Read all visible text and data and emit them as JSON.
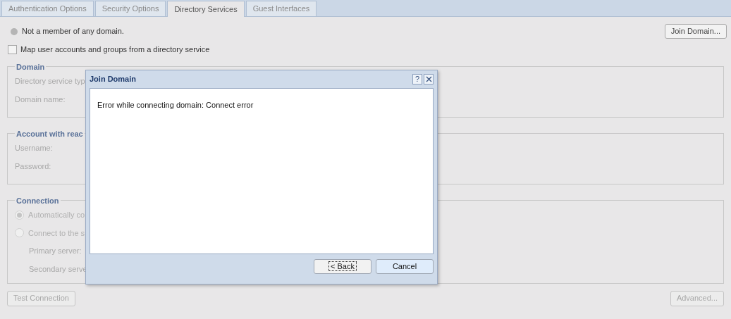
{
  "tabs": [
    {
      "label": "Authentication Options",
      "selected": false
    },
    {
      "label": "Security Options",
      "selected": false
    },
    {
      "label": "Directory Services",
      "selected": true
    },
    {
      "label": "Guest Interfaces",
      "selected": false
    }
  ],
  "status": {
    "text": "Not a member of any domain."
  },
  "join_button": {
    "label": "Join Domain...",
    "disabled": false
  },
  "map_checkbox": {
    "label": "Map user accounts and groups from a directory service",
    "checked": false
  },
  "sections": [
    {
      "title": "Domain",
      "fields": [
        "Directory service typ",
        "Domain name:"
      ]
    },
    {
      "title": "Account with reac",
      "fields": [
        "Username:",
        "Password:"
      ]
    },
    {
      "title": "Connection",
      "options": [
        {
          "label": "Automatically co",
          "selected": true
        },
        {
          "label": "Connect to the s",
          "selected": false
        }
      ],
      "fields": [
        "Primary server:",
        "Secondary serve"
      ]
    }
  ],
  "bottom_buttons": [
    {
      "label": "Test Connection",
      "disabled": true
    },
    {
      "label": "Advanced...",
      "disabled": true
    }
  ],
  "dialog": {
    "title": "Join Domain",
    "help": "?",
    "message": "Error while connecting domain: Connect error",
    "buttons": [
      {
        "label": "< Back",
        "focused": true,
        "primary": false
      },
      {
        "label": "Cancel",
        "focused": false,
        "primary": true
      }
    ]
  }
}
